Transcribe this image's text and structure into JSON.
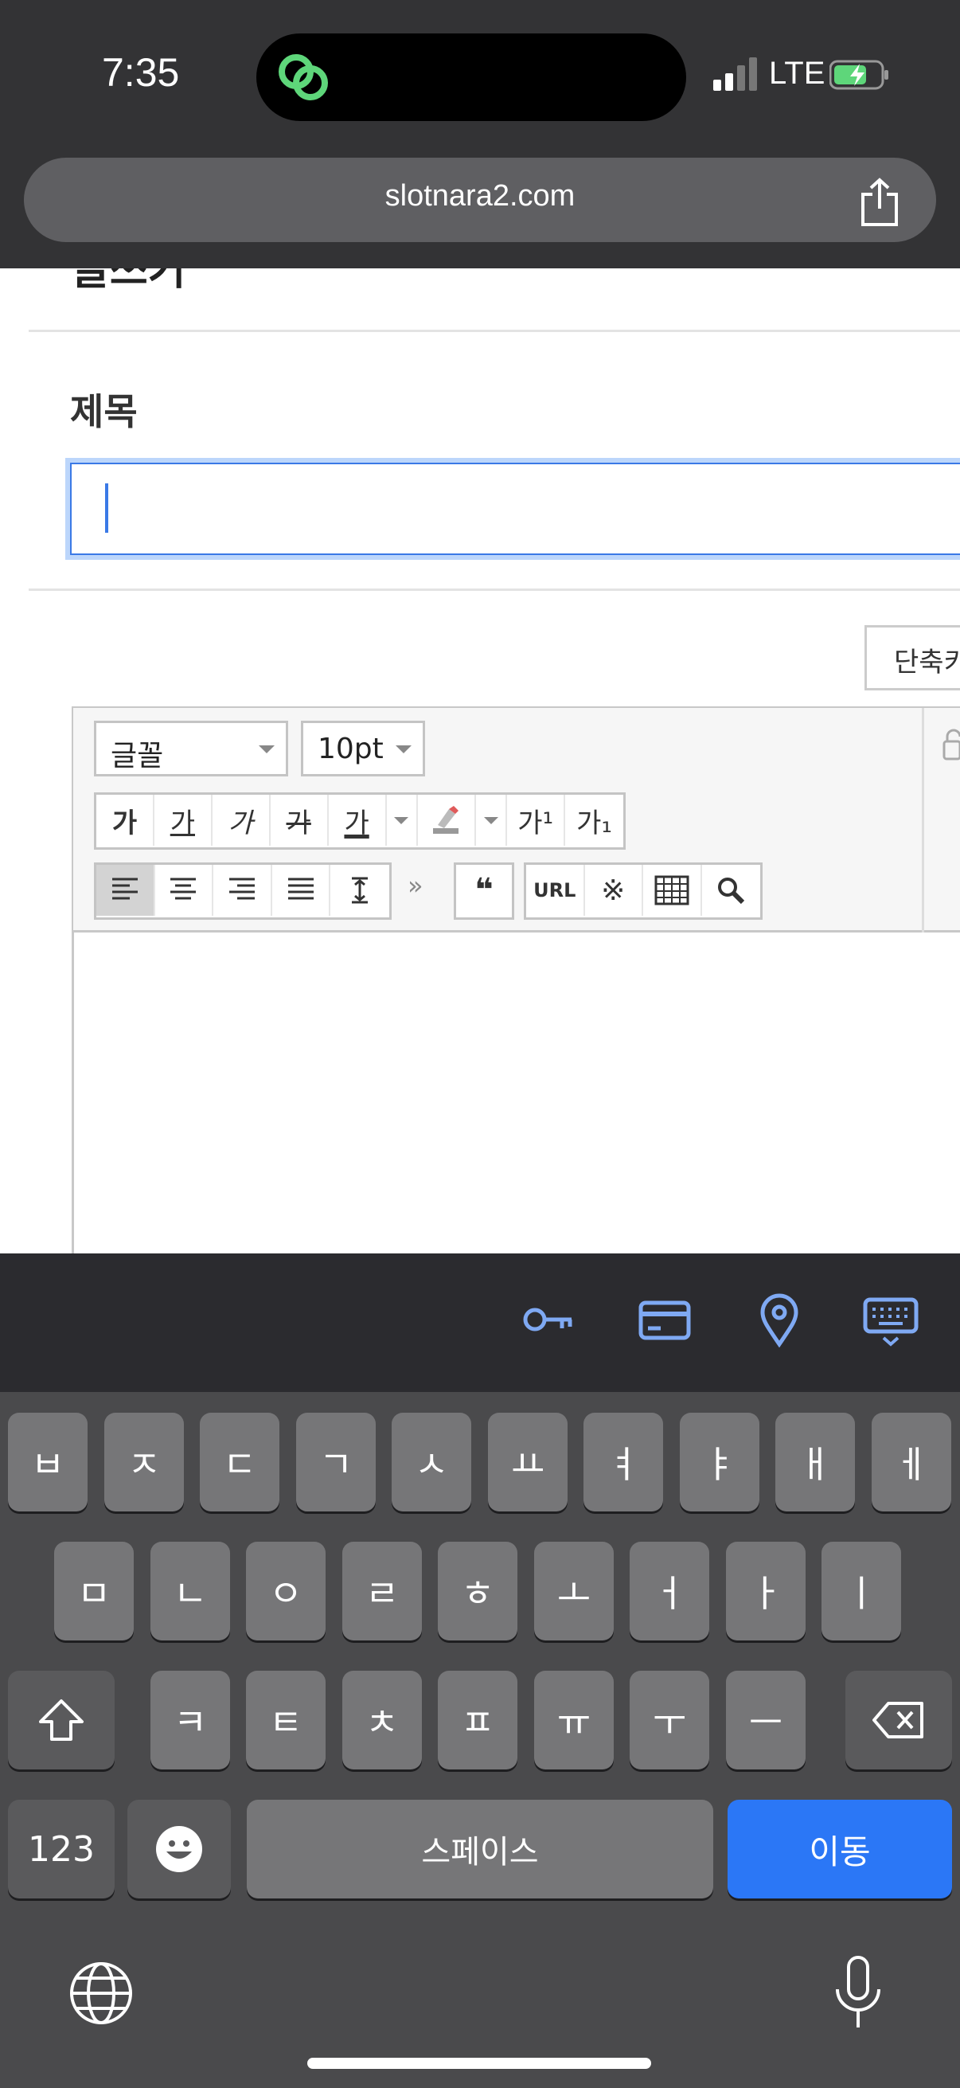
{
  "status_bar": {
    "time": "7:35",
    "carrier": "LTE"
  },
  "browser": {
    "url": "slotnara2.com"
  },
  "page": {
    "heading_partial": "글쓰기",
    "title_label": "제목",
    "title_input_value": "",
    "shortcut_button": "단축키",
    "editor": {
      "font_select": "글꼴",
      "size_select": "10pt",
      "format_buttons": [
        "가",
        "가",
        "가",
        "가",
        "가",
        "",
        "가¹",
        "가₁"
      ],
      "align_buttons": [
        "align-left-icon",
        "align-center-icon",
        "align-right-icon",
        "align-justify-icon",
        "line-height-icon"
      ],
      "more_label": "»",
      "quote_label": "❝",
      "url_label": "URL",
      "special_char": "※"
    }
  },
  "keyboard": {
    "row1": [
      "ㅂ",
      "ㅈ",
      "ㄷ",
      "ㄱ",
      "ㅅ",
      "ㅛ",
      "ㅕ",
      "ㅑ",
      "ㅐ",
      "ㅔ"
    ],
    "row2": [
      "ㅁ",
      "ㄴ",
      "ㅇ",
      "ㄹ",
      "ㅎ",
      "ㅗ",
      "ㅓ",
      "ㅏ",
      "ㅣ"
    ],
    "row3": [
      "ㅋ",
      "ㅌ",
      "ㅊ",
      "ㅍ",
      "ㅠ",
      "ㅜ",
      "ㅡ"
    ],
    "numbers_key": "123",
    "space_key": "스페이스",
    "go_key": "이동"
  },
  "colors": {
    "accent": "#2b77f6",
    "focus_border": "#3a79e6",
    "keyboard_bg": "#4a4a4c",
    "key_bg": "#767678"
  }
}
